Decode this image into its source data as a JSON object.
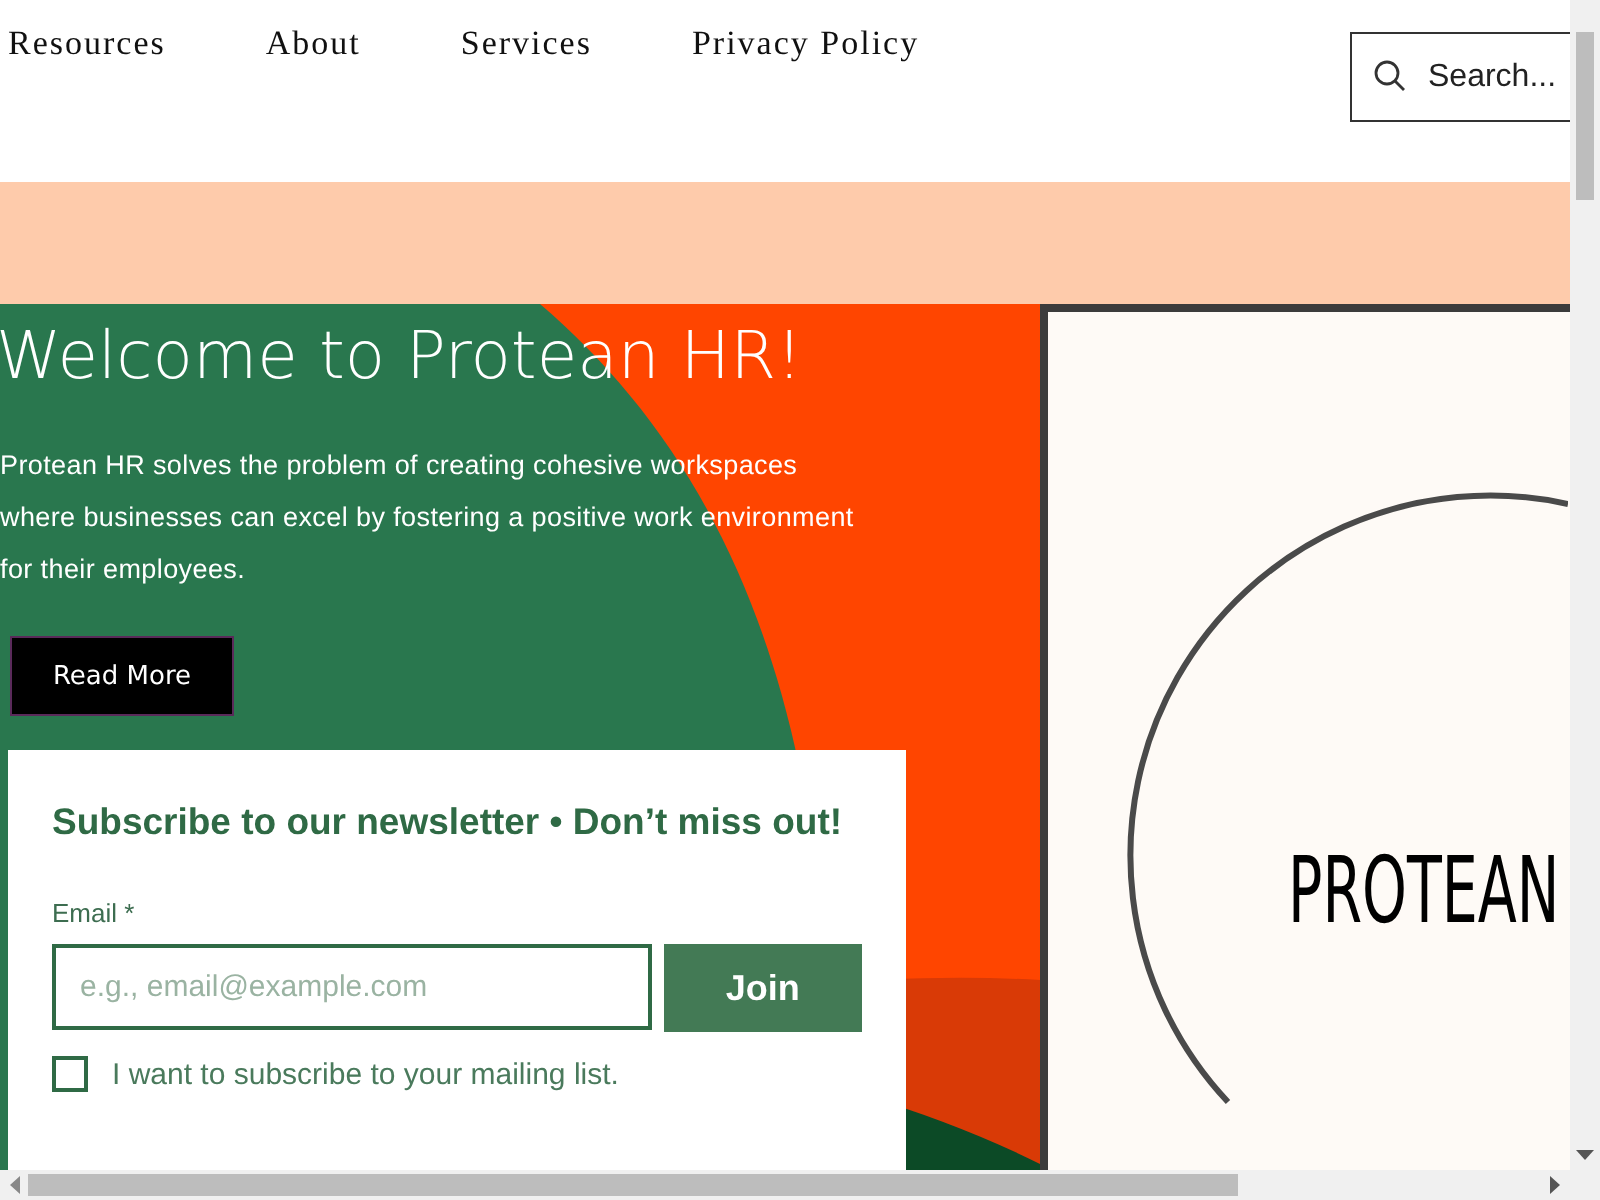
{
  "nav": {
    "links": [
      {
        "label": "Resources"
      },
      {
        "label": "About"
      },
      {
        "label": "Services"
      },
      {
        "label": "Privacy Policy"
      }
    ]
  },
  "search": {
    "placeholder": "Search..."
  },
  "hero": {
    "title": "Welcome to Protean HR!",
    "body": "Protean HR solves the problem of creating cohesive workspaces where businesses can excel by fostering a positive work environment for their employees.",
    "button": "Read More"
  },
  "newsletter": {
    "title": "Subscribe to our newsletter • Don’t miss out!",
    "email_label": "Email *",
    "email_placeholder": "e.g., email@example.com",
    "join_button": "Join",
    "consent": {
      "label": "I want to subscribe to your mailing list.",
      "checked": false
    }
  },
  "logo": {
    "text": "PROTEAN"
  }
}
